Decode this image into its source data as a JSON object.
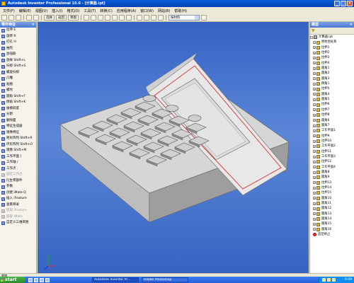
{
  "window": {
    "title": "Autodesk Inventor Professional 10.0 - [计算器.ipt]"
  },
  "menu": [
    "文件(F)",
    "编辑(E)",
    "视图(V)",
    "插入(I)",
    "格式(O)",
    "工具(T)",
    "转换(C)",
    "应用程序(A)",
    "窗口(W)",
    "网站(B)",
    "帮助(H)"
  ],
  "toolbar": {
    "select_label": "选择",
    "return_label": "返回",
    "sketch_label": "草图",
    "color_value": "按材料"
  },
  "left_panel": {
    "title": "零件特征",
    "close_label": "×",
    "tools": [
      {
        "label": "拉伸  E",
        "dim": false
      },
      {
        "label": "旋转  R",
        "dim": false
      },
      {
        "label": "打孔  H",
        "dim": false
      },
      {
        "label": "抽壳",
        "dim": false
      },
      {
        "label": "加强筋",
        "dim": false
      },
      {
        "label": "放样  Shift+L",
        "dim": false
      },
      {
        "label": "扫掠  Shift+S",
        "dim": false
      },
      {
        "label": "螺旋扫掠",
        "dim": false
      },
      {
        "label": "凸雕",
        "dim": false
      },
      {
        "label": "贴图",
        "dim": false
      },
      {
        "label": "螺纹",
        "dim": false
      },
      {
        "label": "圆角  Shift+F",
        "dim": false
      },
      {
        "label": "倒角  Shift+K",
        "dim": false
      },
      {
        "label": "拔模斜度",
        "dim": false
      },
      {
        "label": "分割",
        "dim": false
      },
      {
        "label": "删除面",
        "dim": false
      },
      {
        "label": "特征生成器",
        "dim": false
      },
      {
        "label": "镜像特征",
        "dim": false
      },
      {
        "label": "矩形阵列  Shift+R",
        "dim": false
      },
      {
        "label": "环形阵列  Shift+O",
        "dim": false
      },
      {
        "label": "镜像  Shift+M",
        "dim": false
      },
      {
        "label": "工作平面  ]",
        "dim": false
      },
      {
        "label": "工作轴  /",
        "dim": false
      },
      {
        "label": "工作点  .",
        "dim": false
      },
      {
        "label": "固定工作点",
        "dim": true
      },
      {
        "label": "衍生零部件",
        "dim": false
      },
      {
        "label": "参数",
        "dim": false
      },
      {
        "label": "创建 iMate  Q",
        "dim": false
      },
      {
        "label": "插入 iFeature",
        "dim": false
      },
      {
        "label": "查看目录",
        "dim": false
      },
      {
        "label": "提取 iFeature",
        "dim": true
      },
      {
        "label": "提取 iMate",
        "dim": true
      },
      {
        "label": "自定义三维草图",
        "dim": false
      }
    ]
  },
  "browser": {
    "title": "模型",
    "close_label": "×",
    "root": "计算器.ipt",
    "nodes": [
      "原始坐标系",
      "拉伸1",
      "拉伸2",
      "拉伸3",
      "拉伸4",
      "圆角1",
      "圆角2",
      "圆角3",
      "倒角1",
      "拉伸5",
      "圆角4",
      "圆角5",
      "拉伸6",
      "拉伸7",
      "拉伸8",
      "圆角6",
      "圆角7",
      "工作平面1",
      "拉伸9",
      "拉伸10",
      "工作平面2",
      "拉伸11",
      "工作平面3",
      "拉伸12",
      "工作平面4",
      "圆角8",
      "圆角9",
      "拉伸13",
      "拉伸14",
      "拉伸15",
      "圆角10",
      "圆角11",
      "圆角12",
      "圆角13",
      "圆角14",
      "圆角15",
      "圆角16"
    ],
    "end_label": "造型终止"
  },
  "statusbar": {
    "text": "就绪"
  },
  "taskbar": {
    "start_label": "start",
    "tasks": [
      "Autodesk Inventor Pr...",
      "Adobe Photoshop"
    ],
    "clock": "9:09"
  },
  "colors": {
    "viewport_top": "#3563c4",
    "panel_header": "#4a78d0",
    "taskbar": "#245edb",
    "faceplate_accent": "#d82020"
  }
}
